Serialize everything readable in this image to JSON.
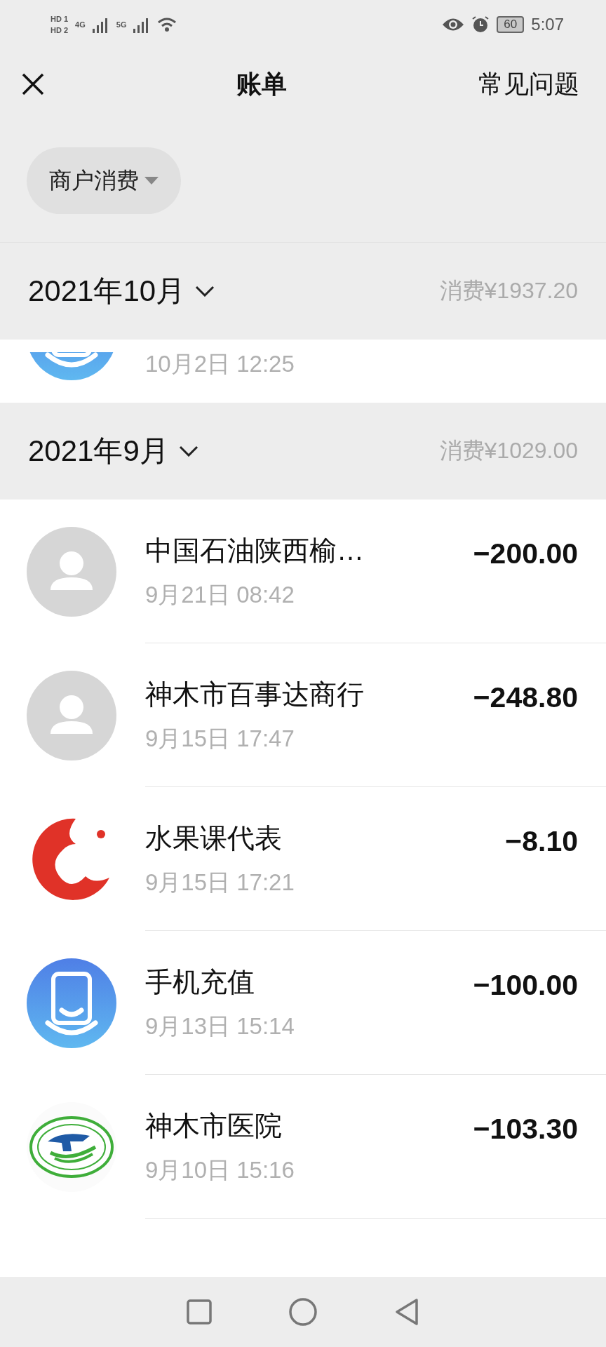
{
  "status_bar": {
    "sims": [
      {
        "badge": "HD",
        "slot": "1"
      },
      {
        "badge": "HD",
        "slot": "2"
      }
    ],
    "network_1": "4G",
    "network_2": "5G",
    "battery": "60",
    "time": "5:07"
  },
  "header": {
    "title": "账单",
    "help": "常见问题"
  },
  "filter": {
    "label": "商户消费"
  },
  "months": [
    {
      "label": "2021年10月",
      "summary": "消费¥1937.20",
      "transactions": [
        {
          "kind": "phone",
          "time": "10月2日 12:25",
          "partial": true
        }
      ]
    },
    {
      "label": "2021年9月",
      "summary": "消费¥1029.00",
      "transactions": [
        {
          "kind": "person",
          "name": "中国石油陕西榆…",
          "time": "9月21日 08:42",
          "amount": "−200.00"
        },
        {
          "kind": "person",
          "name": "神木市百事达商行",
          "time": "9月15日 17:47",
          "amount": "−248.80"
        },
        {
          "kind": "fruit",
          "name": "水果课代表",
          "time": "9月15日 17:21",
          "amount": "−8.10"
        },
        {
          "kind": "phone",
          "name": "手机充值",
          "time": "9月13日 15:14",
          "amount": "−100.00"
        },
        {
          "kind": "hospital",
          "name": "神木市医院",
          "time": "9月10日 15:16",
          "amount": "−103.30"
        }
      ]
    }
  ]
}
